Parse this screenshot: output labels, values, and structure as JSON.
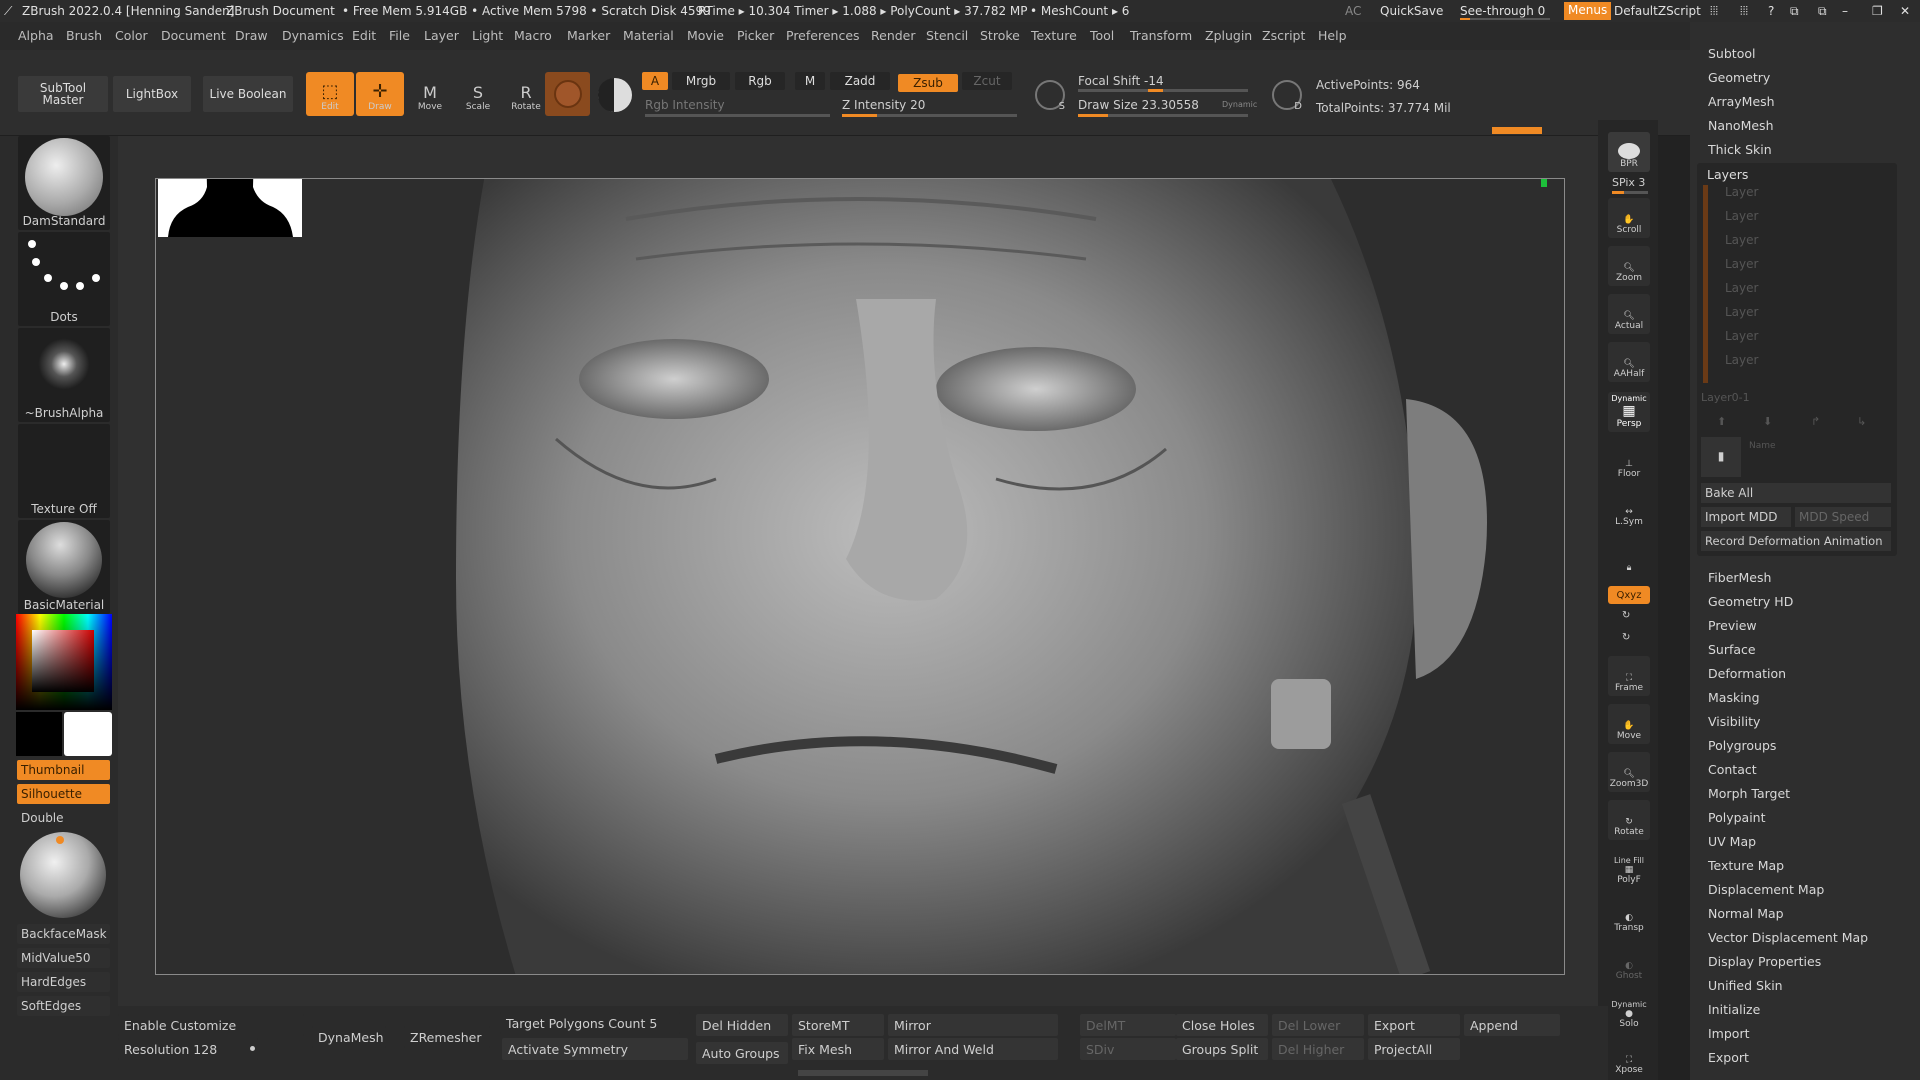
{
  "title": {
    "app": "ZBrush 2022.0.4 [Henning Sanden]",
    "doc": "ZBrush Document",
    "mem": "• Free Mem 5.914GB • Active Mem 5798 • Scratch Disk 4599",
    "rtime": "RTime ▸ 10.304 Timer ▸ 1.088 ▸ PolyCount ▸ 37.782 MP",
    "meshcount": "• MeshCount ▸ 6",
    "ac": "AC",
    "quicksave": "QuickSave",
    "seethrough": "See-through  0",
    "menus": "Menus",
    "script": "DefaultZScript"
  },
  "menu": [
    "Alpha",
    "Brush",
    "Color",
    "Document",
    "Draw",
    "Dynamics",
    "Edit",
    "File",
    "Layer",
    "Light",
    "Macro",
    "Marker",
    "Material",
    "Movie",
    "Picker",
    "Preferences",
    "Render",
    "Stencil",
    "Stroke",
    "Texture",
    "Tool",
    "Transform",
    "Zplugin",
    "Zscript",
    "Help"
  ],
  "toolbar": {
    "subtool": "SubTool Master",
    "lightbox": "LightBox",
    "liveboolean": "Live Boolean",
    "edit": "Edit",
    "draw": "Draw",
    "move": "Move",
    "scale": "Scale",
    "rotate": "Rotate",
    "a": "A",
    "mrgb": "Mrgb",
    "rgb": "Rgb",
    "m": "M",
    "zadd": "Zadd",
    "zsub": "Zsub",
    "zcut": "Zcut",
    "rgb_intensity": "Rgb Intensity",
    "z_intensity": "Z Intensity 20",
    "z_intensity_value": 20,
    "focal_shift": "Focal Shift -14",
    "focal_shift_value": -14,
    "draw_size": "Draw Size 23.30558",
    "dynamic": "Dynamic",
    "active_points": "ActivePoints: 964",
    "total_points": "TotalPoints: 37.774 Mil",
    "s": "S",
    "d": "D"
  },
  "left": {
    "brush": "DamStandard",
    "stroke": "Dots",
    "alpha": "~BrushAlpha",
    "texture": "Texture Off",
    "material": "BasicMaterial",
    "thumbnail": "Thumbnail",
    "silhouette": "Silhouette",
    "double": "Double",
    "backface": "BackfaceMask",
    "midvalue": "MidValue50",
    "hardedges": "HardEdges",
    "softedges": "SoftEdges"
  },
  "rightshelf": {
    "bpr": "BPR",
    "spix": "SPix 3",
    "scroll": "Scroll",
    "zoom": "Zoom",
    "actual": "Actual",
    "aahalf": "AAHalf",
    "dynamic": "Dynamic",
    "persp": "Persp",
    "floor": "Floor",
    "lsym": "L.Sym",
    "xyz": "Qxyz",
    "frame": "Frame",
    "move": "Move",
    "zoom3d": "Zoom3D",
    "rotate": "Rotate",
    "linefill": "Line Fill",
    "polyf": "PolyF",
    "transp": "Transp",
    "ghost": "Ghost",
    "solo": "Solo",
    "xpose": "Xpose"
  },
  "panel": {
    "top": [
      "Subtool",
      "Geometry",
      "ArrayMesh",
      "NanoMesh",
      "Thick Skin"
    ],
    "layers_title": "Layers",
    "layers": [
      "Layer",
      "Layer",
      "Layer",
      "Layer",
      "Layer",
      "Layer",
      "Layer",
      "Layer"
    ],
    "layer01": "Layer0-1",
    "name": "Name",
    "bake": "Bake All",
    "import": "Import MDD",
    "mddspeed": "MDD Speed",
    "record": "Record Deformation Animation",
    "bottom": [
      "FiberMesh",
      "Geometry HD",
      "Preview",
      "Surface",
      "Deformation",
      "Masking",
      "Visibility",
      "Polygroups",
      "Contact",
      "Morph Target",
      "Polypaint",
      "UV Map",
      "Texture Map",
      "Displacement Map",
      "Normal Map",
      "Vector Displacement Map",
      "Display Properties",
      "Unified Skin",
      "Initialize",
      "Import",
      "Export"
    ]
  },
  "bottom": {
    "enable": "Enable Customize",
    "resolution": "Resolution 128",
    "dynamesh": "DynaMesh",
    "zremesher": "ZRemesher",
    "target": "Target Polygons Count 5",
    "symmetry": "Activate Symmetry",
    "delhidden": "Del Hidden",
    "autogroups": "Auto Groups",
    "storemt": "StoreMT",
    "fixmesh": "Fix Mesh",
    "mirror": "Mirror",
    "mirrorweld": "Mirror And Weld",
    "delmt": "DelMT",
    "sdiv": "SDiv",
    "closeholes": "Close Holes",
    "groupssplit": "Groups Split",
    "dellower": "Del Lower",
    "delhigher": "Del Higher",
    "export": "Export",
    "projectall": "ProjectAll",
    "append": "Append"
  },
  "colors": {
    "accent": "#f08a24",
    "bg": "#2e2e2e"
  }
}
